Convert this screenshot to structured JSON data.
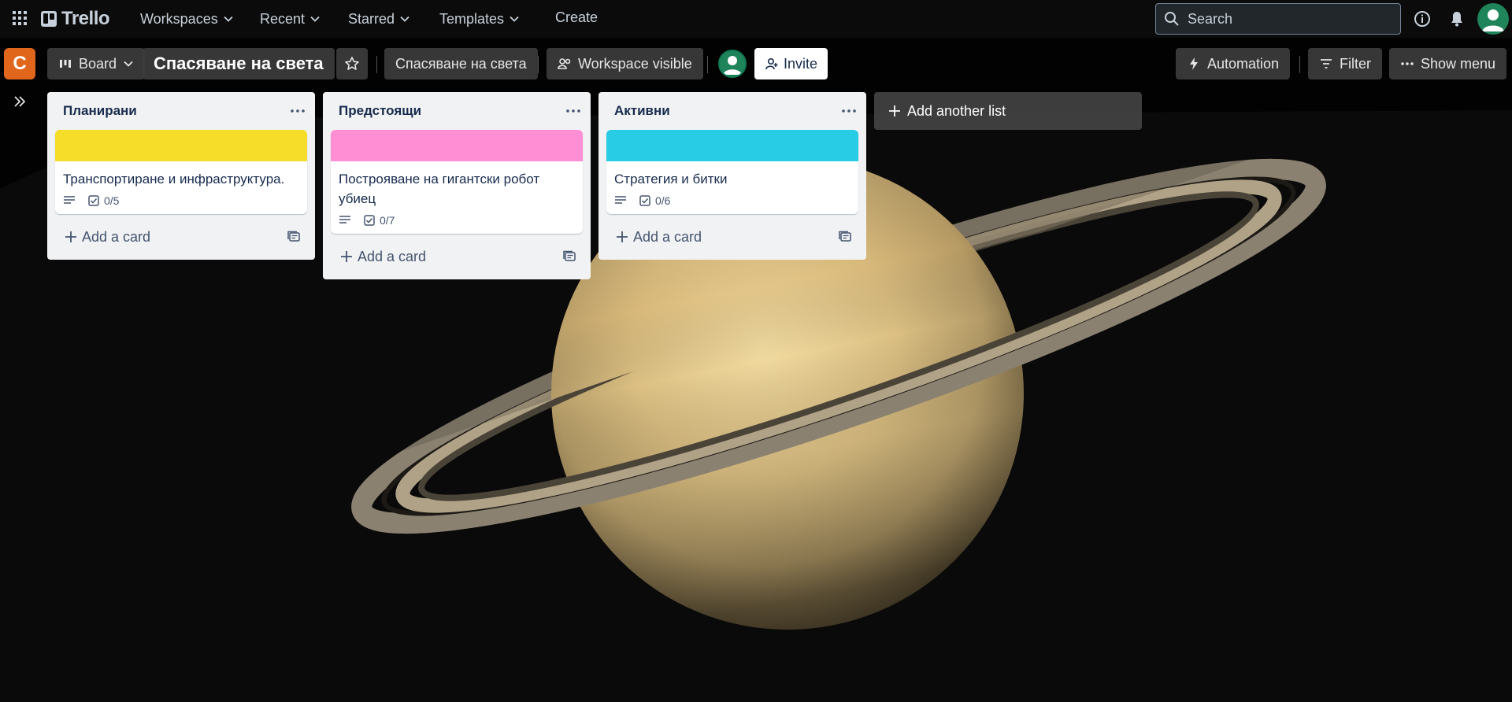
{
  "header": {
    "app_name": "Trello",
    "nav": [
      {
        "label": "Workspaces"
      },
      {
        "label": "Recent"
      },
      {
        "label": "Starred"
      },
      {
        "label": "Templates"
      }
    ],
    "create_label": "Create",
    "search_placeholder": "Search"
  },
  "board": {
    "workspace_initial": "C",
    "view_label": "Board",
    "title": "Спасяване на света",
    "workspace_name": "Спасяване на света",
    "visibility_label": "Workspace visible",
    "invite_label": "Invite",
    "automation_label": "Automation",
    "filter_label": "Filter",
    "show_menu_label": "Show menu"
  },
  "lists": [
    {
      "title": "Планирани",
      "cards": [
        {
          "cover_color": "#f5dd29",
          "title": "Транспортиране и инфраструктура.",
          "checklist": "0/5"
        }
      ],
      "add_card_label": "Add a card"
    },
    {
      "title": "Предстоящи",
      "cards": [
        {
          "cover_color": "#ff8ed4",
          "title": "Построяване на гигантски робот убиец",
          "checklist": "0/7"
        }
      ],
      "add_card_label": "Add a card"
    },
    {
      "title": "Активни",
      "cards": [
        {
          "cover_color": "#29cce5",
          "title": "Стратегия и битки",
          "checklist": "0/6"
        }
      ],
      "add_card_label": "Add a card"
    }
  ],
  "add_list_label": "Add another list"
}
